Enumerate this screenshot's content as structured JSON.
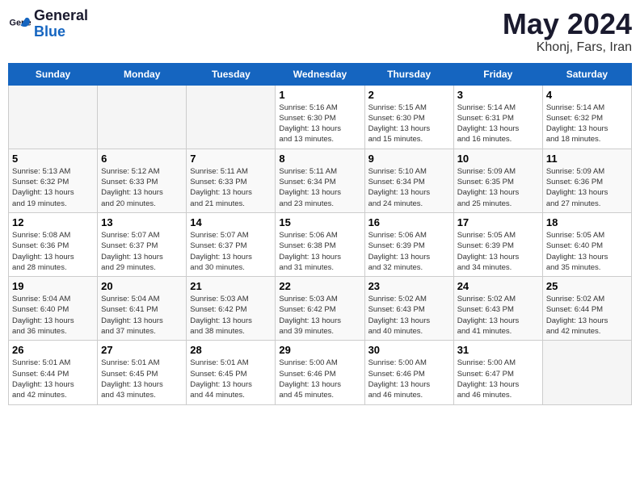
{
  "logo": {
    "text_general": "General",
    "text_blue": "Blue"
  },
  "header": {
    "month_year": "May 2024",
    "location": "Khonj, Fars, Iran"
  },
  "days_of_week": [
    "Sunday",
    "Monday",
    "Tuesday",
    "Wednesday",
    "Thursday",
    "Friday",
    "Saturday"
  ],
  "weeks": [
    [
      {
        "day": "",
        "info": ""
      },
      {
        "day": "",
        "info": ""
      },
      {
        "day": "",
        "info": ""
      },
      {
        "day": "1",
        "info": "Sunrise: 5:16 AM\nSunset: 6:30 PM\nDaylight: 13 hours\nand 13 minutes."
      },
      {
        "day": "2",
        "info": "Sunrise: 5:15 AM\nSunset: 6:30 PM\nDaylight: 13 hours\nand 15 minutes."
      },
      {
        "day": "3",
        "info": "Sunrise: 5:14 AM\nSunset: 6:31 PM\nDaylight: 13 hours\nand 16 minutes."
      },
      {
        "day": "4",
        "info": "Sunrise: 5:14 AM\nSunset: 6:32 PM\nDaylight: 13 hours\nand 18 minutes."
      }
    ],
    [
      {
        "day": "5",
        "info": "Sunrise: 5:13 AM\nSunset: 6:32 PM\nDaylight: 13 hours\nand 19 minutes."
      },
      {
        "day": "6",
        "info": "Sunrise: 5:12 AM\nSunset: 6:33 PM\nDaylight: 13 hours\nand 20 minutes."
      },
      {
        "day": "7",
        "info": "Sunrise: 5:11 AM\nSunset: 6:33 PM\nDaylight: 13 hours\nand 21 minutes."
      },
      {
        "day": "8",
        "info": "Sunrise: 5:11 AM\nSunset: 6:34 PM\nDaylight: 13 hours\nand 23 minutes."
      },
      {
        "day": "9",
        "info": "Sunrise: 5:10 AM\nSunset: 6:34 PM\nDaylight: 13 hours\nand 24 minutes."
      },
      {
        "day": "10",
        "info": "Sunrise: 5:09 AM\nSunset: 6:35 PM\nDaylight: 13 hours\nand 25 minutes."
      },
      {
        "day": "11",
        "info": "Sunrise: 5:09 AM\nSunset: 6:36 PM\nDaylight: 13 hours\nand 27 minutes."
      }
    ],
    [
      {
        "day": "12",
        "info": "Sunrise: 5:08 AM\nSunset: 6:36 PM\nDaylight: 13 hours\nand 28 minutes."
      },
      {
        "day": "13",
        "info": "Sunrise: 5:07 AM\nSunset: 6:37 PM\nDaylight: 13 hours\nand 29 minutes."
      },
      {
        "day": "14",
        "info": "Sunrise: 5:07 AM\nSunset: 6:37 PM\nDaylight: 13 hours\nand 30 minutes."
      },
      {
        "day": "15",
        "info": "Sunrise: 5:06 AM\nSunset: 6:38 PM\nDaylight: 13 hours\nand 31 minutes."
      },
      {
        "day": "16",
        "info": "Sunrise: 5:06 AM\nSunset: 6:39 PM\nDaylight: 13 hours\nand 32 minutes."
      },
      {
        "day": "17",
        "info": "Sunrise: 5:05 AM\nSunset: 6:39 PM\nDaylight: 13 hours\nand 34 minutes."
      },
      {
        "day": "18",
        "info": "Sunrise: 5:05 AM\nSunset: 6:40 PM\nDaylight: 13 hours\nand 35 minutes."
      }
    ],
    [
      {
        "day": "19",
        "info": "Sunrise: 5:04 AM\nSunset: 6:40 PM\nDaylight: 13 hours\nand 36 minutes."
      },
      {
        "day": "20",
        "info": "Sunrise: 5:04 AM\nSunset: 6:41 PM\nDaylight: 13 hours\nand 37 minutes."
      },
      {
        "day": "21",
        "info": "Sunrise: 5:03 AM\nSunset: 6:42 PM\nDaylight: 13 hours\nand 38 minutes."
      },
      {
        "day": "22",
        "info": "Sunrise: 5:03 AM\nSunset: 6:42 PM\nDaylight: 13 hours\nand 39 minutes."
      },
      {
        "day": "23",
        "info": "Sunrise: 5:02 AM\nSunset: 6:43 PM\nDaylight: 13 hours\nand 40 minutes."
      },
      {
        "day": "24",
        "info": "Sunrise: 5:02 AM\nSunset: 6:43 PM\nDaylight: 13 hours\nand 41 minutes."
      },
      {
        "day": "25",
        "info": "Sunrise: 5:02 AM\nSunset: 6:44 PM\nDaylight: 13 hours\nand 42 minutes."
      }
    ],
    [
      {
        "day": "26",
        "info": "Sunrise: 5:01 AM\nSunset: 6:44 PM\nDaylight: 13 hours\nand 42 minutes."
      },
      {
        "day": "27",
        "info": "Sunrise: 5:01 AM\nSunset: 6:45 PM\nDaylight: 13 hours\nand 43 minutes."
      },
      {
        "day": "28",
        "info": "Sunrise: 5:01 AM\nSunset: 6:45 PM\nDaylight: 13 hours\nand 44 minutes."
      },
      {
        "day": "29",
        "info": "Sunrise: 5:00 AM\nSunset: 6:46 PM\nDaylight: 13 hours\nand 45 minutes."
      },
      {
        "day": "30",
        "info": "Sunrise: 5:00 AM\nSunset: 6:46 PM\nDaylight: 13 hours\nand 46 minutes."
      },
      {
        "day": "31",
        "info": "Sunrise: 5:00 AM\nSunset: 6:47 PM\nDaylight: 13 hours\nand 46 minutes."
      },
      {
        "day": "",
        "info": ""
      }
    ]
  ]
}
